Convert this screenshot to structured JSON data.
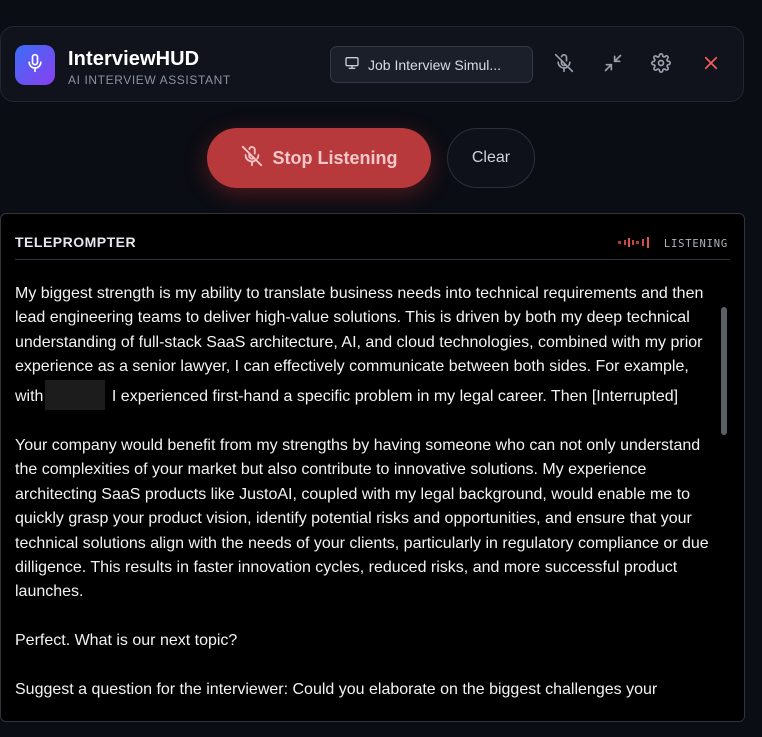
{
  "app": {
    "title": "InterviewHUD",
    "subtitle": "AI INTERVIEW ASSISTANT",
    "icon": "microphone-icon"
  },
  "header": {
    "mode_select_value": "Job Interview Simul...",
    "mode_icon": "monitor-icon",
    "actions": [
      {
        "name": "mute-mic-icon"
      },
      {
        "name": "minimize-icon"
      },
      {
        "name": "settings-icon"
      },
      {
        "name": "close-icon"
      }
    ]
  },
  "controls": {
    "stop_label": "Stop Listening",
    "clear_label": "Clear"
  },
  "teleprompter": {
    "title": "TELEPROMPTER",
    "status": "LISTENING",
    "paragraphs": [
      {
        "before": "My biggest strength is my ability to translate business needs into technical requirements and then lead engineering teams to deliver high-value solutions. This is driven by both my deep technical understanding of full-stack SaaS architecture, AI, and cloud technologies, combined with my prior experience as a senior lawyer, I can effectively communicate between both sides. For example, with",
        "after": " I experienced first-hand a specific problem in my legal career. Then [Interrupted]"
      },
      {
        "text": "Your company would benefit from my strengths by having someone who can not only understand the complexities of your market but also contribute to innovative solutions. My experience architecting SaaS products like JustoAI, coupled with my legal background, would enable me to quickly grasp your product vision, identify potential risks and opportunities, and ensure that your technical solutions align with the needs of your clients, particularly in regulatory compliance or due dilligence. This results in faster innovation cycles, reduced risks, and more successful product launches."
      },
      {
        "text": "Perfect. What is our next topic?"
      },
      {
        "text": "Suggest a question for the interviewer: Could you elaborate on the biggest challenges your"
      }
    ]
  },
  "colors": {
    "accent_red": "#b8393b",
    "close_red": "#f05a5a",
    "logo_gradient_start": "#3b6df6",
    "logo_gradient_end": "#8a3ff0",
    "background": "#0b0d14"
  }
}
